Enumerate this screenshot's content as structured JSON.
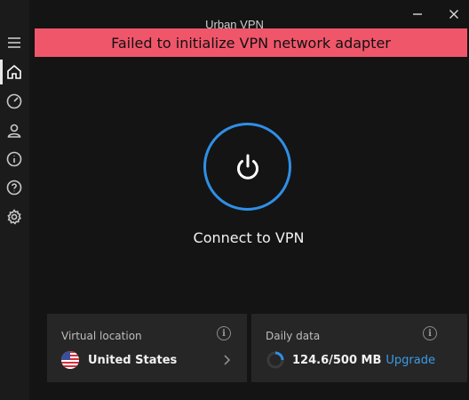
{
  "window": {
    "title": "Urban VPN",
    "controls": {
      "minimize_icon": "minimize-icon",
      "close_icon": "close-icon"
    }
  },
  "sidebar": {
    "items": [
      {
        "icon": "menu-icon",
        "active": false
      },
      {
        "icon": "home-icon",
        "active": true
      },
      {
        "icon": "speed-icon",
        "active": false
      },
      {
        "icon": "account-icon",
        "active": false
      },
      {
        "icon": "info-icon",
        "active": false
      },
      {
        "icon": "help-icon",
        "active": false
      },
      {
        "icon": "settings-icon",
        "active": false
      }
    ]
  },
  "banner": {
    "text": "Failed to initialize VPN network adapter",
    "color": "#f0566a"
  },
  "main": {
    "connect_label": "Connect to VPN",
    "power_icon": "power-icon",
    "accent": "#2f8fe6"
  },
  "location_card": {
    "label": "Virtual location",
    "value": "United States",
    "flag": "us-flag-icon"
  },
  "data_card": {
    "label": "Daily data",
    "value": "124.6/500 MB",
    "used_fraction": 0.2492,
    "upgrade_label": "Upgrade",
    "link_color": "#3a9be8"
  }
}
